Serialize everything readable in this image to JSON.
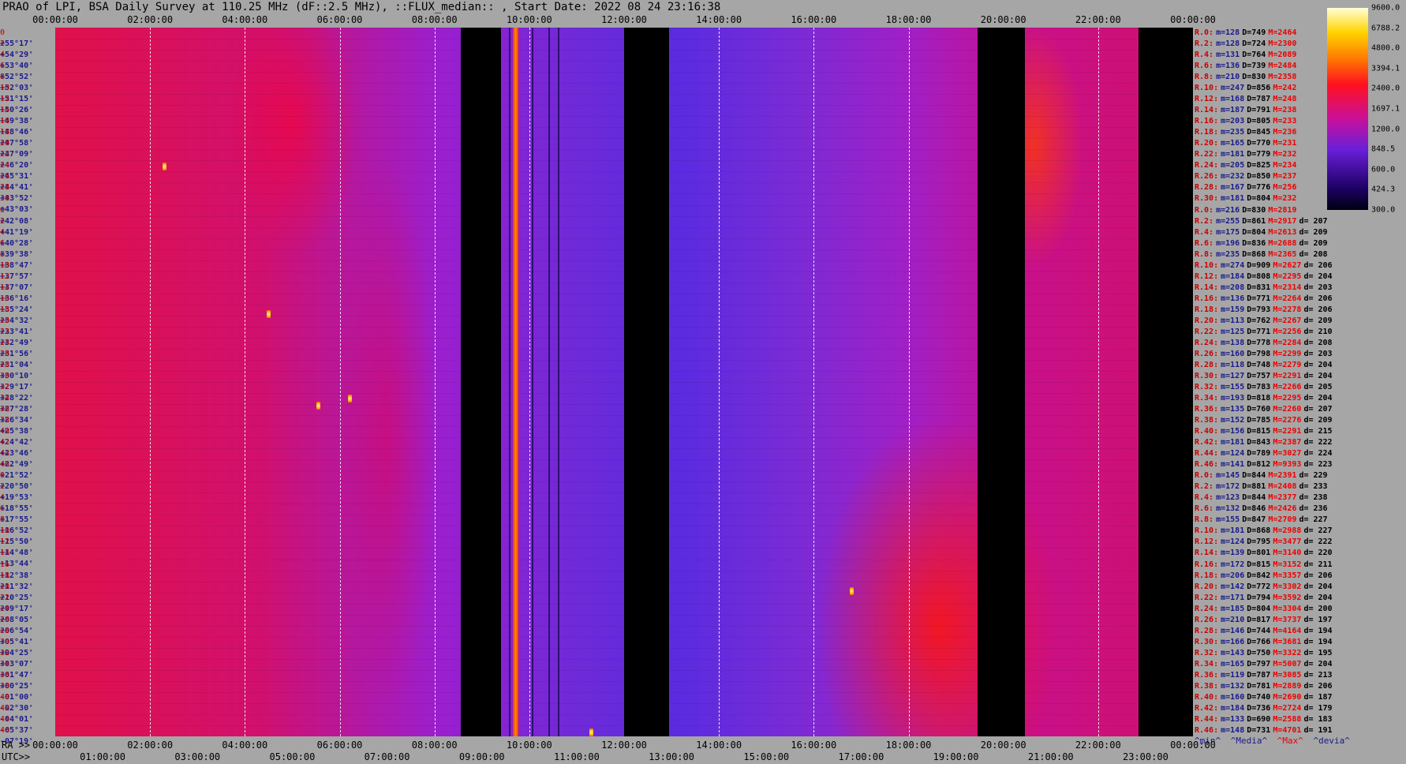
{
  "title": "PRAO of LPI, BSA Daily Survey at 110.25 MHz (dF::2.5 MHz), ::FLUX_median:: , Start Date: 2022 08 24 23:16:38",
  "axis": {
    "ra_label": "RA >>",
    "utc_label": "UTC>>",
    "ra_ticks_top": [
      "00:00:00",
      "02:00:00",
      "04:00:00",
      "06:00:00",
      "08:00:00",
      "10:00:00",
      "12:00:00",
      "14:00:00",
      "16:00:00",
      "18:00:00",
      "20:00:00",
      "22:00:00",
      "00:00:00"
    ],
    "ra_ticks_bottom": [
      "00:00:00",
      "02:00:00",
      "04:00:00",
      "06:00:00",
      "08:00:00",
      "10:00:00",
      "12:00:00",
      "14:00:00",
      "16:00:00",
      "18:00:00",
      "20:00:00",
      "22:00:00",
      "00:00:00"
    ],
    "utc_ticks": [
      "01:00:00",
      "03:00:00",
      "05:00:00",
      "07:00:00",
      "09:00:00",
      "11:00:00",
      "13:00:00",
      "15:00:00",
      "17:00:00",
      "19:00:00",
      "21:00:00",
      "23:00:00"
    ]
  },
  "colorbar": {
    "labels": [
      "9600.0",
      "6788.2",
      "4800.0",
      "3394.1",
      "2400.0",
      "1697.1",
      "1200.0",
      "848.5",
      "600.0",
      "424.3",
      "300.0"
    ]
  },
  "declinations": [
    "+55°17'",
    "+54°29'",
    "+53°40'",
    "+52°52'",
    "+52°03'",
    "+51°15'",
    "+50°26'",
    "+49°38'",
    "+48°46'",
    "+47°58'",
    "+47°09'",
    "+46°20'",
    "+45°31'",
    "+44°41'",
    "+43°52'",
    "+43°03'",
    "+42°08'",
    "+41°19'",
    "+40°28'",
    "+39°38'",
    "+38°47'",
    "+37°57'",
    "+37°07'",
    "+36°16'",
    "+35°24'",
    "+34°32'",
    "+33°41'",
    "+32°49'",
    "+31°56'",
    "+31°04'",
    "+30°10'",
    "+29°17'",
    "+28°22'",
    "+27°28'",
    "+26°34'",
    "+25°38'",
    "+24°42'",
    "+23°46'",
    "+22°49'",
    "+21°52'",
    "+20°50'",
    "+19°53'",
    "+18°55'",
    "+17°55'",
    "+16°52'",
    "+15°50'",
    "+14°48'",
    "+13°44'",
    "+12°38'",
    "+11°32'",
    "+10°25'",
    "+09°17'",
    "+08°05'",
    "+06°54'",
    "+05°41'",
    "+04°25'",
    "+03°07'",
    "+01°47'",
    "+00°25'",
    "-01°00'",
    "-02°30'",
    "-04°01'",
    "-05°37'",
    "-07°19'"
  ],
  "row_numbers": [
    "0",
    "2",
    "4",
    "6",
    "8",
    "10",
    "12",
    "14",
    "16",
    "18",
    "20",
    "22",
    "24",
    "26",
    "28",
    "30",
    "0",
    "2",
    "4",
    "6",
    "8",
    "10",
    "12",
    "14",
    "16",
    "18",
    "20",
    "22",
    "24",
    "26",
    "28",
    "30",
    "32",
    "34",
    "36",
    "38",
    "40",
    "42",
    "44",
    "46",
    "0",
    "2",
    "4",
    "6",
    "8",
    "10",
    "12",
    "14",
    "16",
    "18",
    "20",
    "22",
    "24",
    "26",
    "28",
    "30",
    "32",
    "34",
    "36",
    "38",
    "40",
    "42",
    "44",
    "46"
  ],
  "stats": [
    {
      "r": "R.0:",
      "m": "m=128",
      "D": "D=749",
      "M": "M=2464",
      "d": ""
    },
    {
      "r": "R.2:",
      "m": "m=128",
      "D": "D=724",
      "M": "M=2300",
      "d": ""
    },
    {
      "r": "R.4:",
      "m": "m=131",
      "D": "D=764",
      "M": "M=2089",
      "d": ""
    },
    {
      "r": "R.6:",
      "m": "m=136",
      "D": "D=739",
      "M": "M=2484",
      "d": ""
    },
    {
      "r": "R.8:",
      "m": "m=210",
      "D": "D=830",
      "M": "M=2358",
      "d": ""
    },
    {
      "r": "R.10:",
      "m": "m=247",
      "D": "D=856",
      "M": "M=242",
      "d": ""
    },
    {
      "r": "R.12:",
      "m": "m=168",
      "D": "D=787",
      "M": "M=248",
      "d": ""
    },
    {
      "r": "R.14:",
      "m": "m=187",
      "D": "D=791",
      "M": "M=238",
      "d": ""
    },
    {
      "r": "R.16:",
      "m": "m=203",
      "D": "D=805",
      "M": "M=233",
      "d": ""
    },
    {
      "r": "R.18:",
      "m": "m=235",
      "D": "D=845",
      "M": "M=236",
      "d": ""
    },
    {
      "r": "R.20:",
      "m": "m=165",
      "D": "D=770",
      "M": "M=231",
      "d": ""
    },
    {
      "r": "R.22:",
      "m": "m=181",
      "D": "D=779",
      "M": "M=232",
      "d": ""
    },
    {
      "r": "R.24:",
      "m": "m=205",
      "D": "D=825",
      "M": "M=234",
      "d": ""
    },
    {
      "r": "R.26:",
      "m": "m=232",
      "D": "D=850",
      "M": "M=237",
      "d": ""
    },
    {
      "r": "R.28:",
      "m": "m=167",
      "D": "D=776",
      "M": "M=256",
      "d": ""
    },
    {
      "r": "R.30:",
      "m": "m=181",
      "D": "D=804",
      "M": "M=232",
      "d": ""
    },
    {
      "r": "R.0:",
      "m": "m=216",
      "D": "D=830",
      "M": "M=2819",
      "d": ""
    },
    {
      "r": "R.2:",
      "m": "m=255",
      "D": "D=861",
      "M": "M=2917",
      "d": "d= 207"
    },
    {
      "r": "R.4:",
      "m": "m=175",
      "D": "D=804",
      "M": "M=2613",
      "d": "d= 209"
    },
    {
      "r": "R.6:",
      "m": "m=196",
      "D": "D=836",
      "M": "M=2688",
      "d": "d= 209"
    },
    {
      "r": "R.8:",
      "m": "m=235",
      "D": "D=868",
      "M": "M=2365",
      "d": "d= 208"
    },
    {
      "r": "R.10:",
      "m": "m=274",
      "D": "D=909",
      "M": "M=2627",
      "d": "d= 206"
    },
    {
      "r": "R.12:",
      "m": "m=184",
      "D": "D=808",
      "M": "M=2295",
      "d": "d= 204"
    },
    {
      "r": "R.14:",
      "m": "m=208",
      "D": "D=831",
      "M": "M=2314",
      "d": "d= 203"
    },
    {
      "r": "R.16:",
      "m": "m=136",
      "D": "D=771",
      "M": "M=2264",
      "d": "d= 206"
    },
    {
      "r": "R.18:",
      "m": "m=159",
      "D": "D=793",
      "M": "M=2278",
      "d": "d= 206"
    },
    {
      "r": "R.20:",
      "m": "m=113",
      "D": "D=762",
      "M": "M=2267",
      "d": "d= 209"
    },
    {
      "r": "R.22:",
      "m": "m=125",
      "D": "D=771",
      "M": "M=2256",
      "d": "d= 210"
    },
    {
      "r": "R.24:",
      "m": "m=138",
      "D": "D=778",
      "M": "M=2284",
      "d": "d= 208"
    },
    {
      "r": "R.26:",
      "m": "m=160",
      "D": "D=798",
      "M": "M=2299",
      "d": "d= 203"
    },
    {
      "r": "R.28:",
      "m": "m=118",
      "D": "D=748",
      "M": "M=2279",
      "d": "d= 204"
    },
    {
      "r": "R.30:",
      "m": "m=127",
      "D": "D=757",
      "M": "M=2291",
      "d": "d= 204"
    },
    {
      "r": "R.32:",
      "m": "m=155",
      "D": "D=783",
      "M": "M=2266",
      "d": "d= 205"
    },
    {
      "r": "R.34:",
      "m": "m=193",
      "D": "D=818",
      "M": "M=2295",
      "d": "d= 204"
    },
    {
      "r": "R.36:",
      "m": "m=135",
      "D": "D=760",
      "M": "M=2260",
      "d": "d= 207"
    },
    {
      "r": "R.38:",
      "m": "m=152",
      "D": "D=785",
      "M": "M=2276",
      "d": "d= 209"
    },
    {
      "r": "R.40:",
      "m": "m=156",
      "D": "D=815",
      "M": "M=2291",
      "d": "d= 215"
    },
    {
      "r": "R.42:",
      "m": "m=181",
      "D": "D=843",
      "M": "M=2387",
      "d": "d= 222"
    },
    {
      "r": "R.44:",
      "m": "m=124",
      "D": "D=789",
      "M": "M=3027",
      "d": "d= 224"
    },
    {
      "r": "R.46:",
      "m": "m=141",
      "D": "D=812",
      "M": "M=9393",
      "d": "d= 223"
    },
    {
      "r": "R.0:",
      "m": "m=145",
      "D": "D=844",
      "M": "M=2391",
      "d": "d= 229"
    },
    {
      "r": "R.2:",
      "m": "m=172",
      "D": "D=881",
      "M": "M=2408",
      "d": "d= 233"
    },
    {
      "r": "R.4:",
      "m": "m=123",
      "D": "D=844",
      "M": "M=2377",
      "d": "d= 238"
    },
    {
      "r": "R.6:",
      "m": "m=132",
      "D": "D=846",
      "M": "M=2426",
      "d": "d= 236"
    },
    {
      "r": "R.8:",
      "m": "m=155",
      "D": "D=847",
      "M": "M=2709",
      "d": "d= 227"
    },
    {
      "r": "R.10:",
      "m": "m=181",
      "D": "D=868",
      "M": "M=2988",
      "d": "d= 227"
    },
    {
      "r": "R.12:",
      "m": "m=124",
      "D": "D=795",
      "M": "M=3477",
      "d": "d= 222"
    },
    {
      "r": "R.14:",
      "m": "m=139",
      "D": "D=801",
      "M": "M=3140",
      "d": "d= 220"
    },
    {
      "r": "R.16:",
      "m": "m=172",
      "D": "D=815",
      "M": "M=3152",
      "d": "d= 211"
    },
    {
      "r": "R.18:",
      "m": "m=206",
      "D": "D=842",
      "M": "M=3357",
      "d": "d= 206"
    },
    {
      "r": "R.20:",
      "m": "m=142",
      "D": "D=772",
      "M": "M=3302",
      "d": "d= 204"
    },
    {
      "r": "R.22:",
      "m": "m=171",
      "D": "D=794",
      "M": "M=3592",
      "d": "d= 204"
    },
    {
      "r": "R.24:",
      "m": "m=185",
      "D": "D=804",
      "M": "M=3304",
      "d": "d= 200"
    },
    {
      "r": "R.26:",
      "m": "m=210",
      "D": "D=817",
      "M": "M=3737",
      "d": "d= 197"
    },
    {
      "r": "R.28:",
      "m": "m=146",
      "D": "D=744",
      "M": "M=4164",
      "d": "d= 194"
    },
    {
      "r": "R.30:",
      "m": "m=166",
      "D": "D=766",
      "M": "M=3681",
      "d": "d= 194"
    },
    {
      "r": "R.32:",
      "m": "m=143",
      "D": "D=750",
      "M": "M=3322",
      "d": "d= 195"
    },
    {
      "r": "R.34:",
      "m": "m=165",
      "D": "D=797",
      "M": "M=5007",
      "d": "d= 204"
    },
    {
      "r": "R.36:",
      "m": "m=119",
      "D": "D=787",
      "M": "M=3085",
      "d": "d= 213"
    },
    {
      "r": "R.38:",
      "m": "m=132",
      "D": "D=781",
      "M": "M=2889",
      "d": "d= 206"
    },
    {
      "r": "R.40:",
      "m": "m=160",
      "D": "D=740",
      "M": "M=2690",
      "d": "d= 187"
    },
    {
      "r": "R.42:",
      "m": "m=184",
      "D": "D=736",
      "M": "M=2724",
      "d": "d= 179"
    },
    {
      "r": "R.44:",
      "m": "m=133",
      "D": "D=690",
      "M": "M=2588",
      "d": "d= 183"
    },
    {
      "r": "R.46:",
      "m": "m=148",
      "D": "D=731",
      "M": "M=4701",
      "d": "d= 191"
    }
  ],
  "stats_footer": [
    "^min^",
    "^Media^",
    "^Max^",
    "^devia^"
  ],
  "colors": {
    "background": "#a6a6a6",
    "stat_row": "#cc0000",
    "stat_min": "#1a1a8c",
    "stat_max": "#ee0000"
  },
  "chart_data": {
    "type": "heatmap",
    "x_axis": "RA (hours)",
    "x_range_hours": [
      0,
      24
    ],
    "y_range_deg": [
      55.28,
      -7.32
    ],
    "grid": "dashed vertical every 2h RA",
    "blank_intervals_ra_hours": [
      [
        8.55,
        9.4
      ],
      [
        12.0,
        12.95
      ],
      [
        19.45,
        20.45
      ],
      [
        22.85,
        24
      ]
    ],
    "bright_vertical_streaks_ra_hours": [
      9.7
    ],
    "secondary_streaks_ra_hours": [
      9.57,
      10.05,
      10.4,
      10.6
    ],
    "hot_sources": [
      {
        "ra_hours": 5.55,
        "dec_deg": 21.9
      },
      {
        "ra_hours": 6.2,
        "dec_deg": 22.5
      },
      {
        "ra_hours": 4.5,
        "dec_deg": 30.0
      },
      {
        "ra_hours": 11.3,
        "dec_deg": -7.0
      },
      {
        "ra_hours": 16.8,
        "dec_deg": 5.5
      },
      {
        "ra_hours": 2.3,
        "dec_deg": 43.0
      }
    ],
    "colorbar_range": [
      300.0,
      9600.0
    ],
    "colorbar_scale": "log"
  }
}
